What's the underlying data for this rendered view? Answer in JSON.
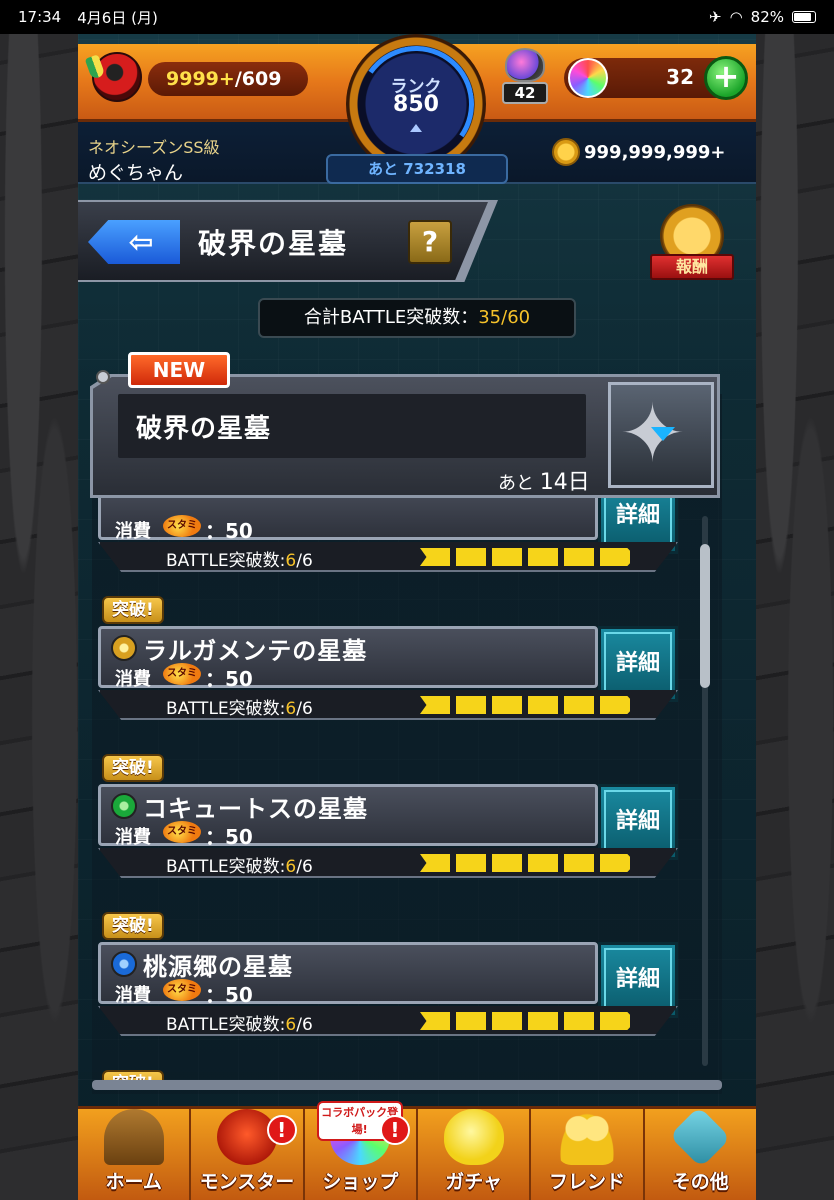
{
  "status_bar": {
    "time": "17:34",
    "date": "4月6日 (月)",
    "battery": "82%"
  },
  "hud": {
    "stamina_current": "9999+",
    "stamina_max": "/609",
    "rank_label": "ランク",
    "rank_value": "850",
    "exp_remaining": "あと 732318",
    "potion_count": "42",
    "orb_count": "32",
    "plus_label": "+",
    "player_title": "ネオシーズンSS級",
    "player_name": "めぐちゃん",
    "coins": "999,999,999+"
  },
  "page": {
    "back_arrow": "⇦",
    "title": "破界の星墓",
    "help": "?",
    "reward_label": "報酬",
    "total_label": "合計BATTLE突破数：",
    "total_value": "35/60"
  },
  "featured": {
    "new_label": "NEW",
    "name": "破界の星墓",
    "remaining_prefix": "あと",
    "remaining_days": "14日"
  },
  "quests": [
    {
      "tag": "",
      "name": "",
      "cost_label": "消費",
      "stamina_label": "スタミナ",
      "cost": "：50",
      "detail": "詳細",
      "progress_label": "BATTLE突破数:",
      "progress_done": "6",
      "progress_total": "/6"
    },
    {
      "tag": "突破!",
      "name": "ラルガメンテの星墓",
      "cost_label": "消費",
      "stamina_label": "スタミナ",
      "cost": "：50",
      "detail": "詳細",
      "progress_label": "BATTLE突破数:",
      "progress_done": "6",
      "progress_total": "/6",
      "element_color": "#d8a020"
    },
    {
      "tag": "突破!",
      "name": "コキュートスの星墓",
      "cost_label": "消費",
      "stamina_label": "スタミナ",
      "cost": "：50",
      "detail": "詳細",
      "progress_label": "BATTLE突破数:",
      "progress_done": "6",
      "progress_total": "/6",
      "element_color": "#1aa83a"
    },
    {
      "tag": "突破!",
      "name": "桃源郷の星墓",
      "cost_label": "消費",
      "stamina_label": "スタミナ",
      "cost": "：50",
      "detail": "詳細",
      "progress_label": "BATTLE突破数:",
      "progress_done": "6",
      "progress_total": "/6",
      "element_color": "#1a6ad8"
    }
  ],
  "next_tag": "突破!",
  "nav": {
    "items": [
      {
        "label": "ホーム",
        "icon": "home-gate-icon"
      },
      {
        "label": "モンスター",
        "icon": "monster-icon",
        "alert": "!"
      },
      {
        "label": "ショップ",
        "icon": "shop-orb-icon",
        "alert": "!",
        "badge": "コラボパック登場!"
      },
      {
        "label": "ガチャ",
        "icon": "gacha-egg-icon"
      },
      {
        "label": "フレンド",
        "icon": "friends-icon"
      },
      {
        "label": "その他",
        "icon": "other-icon"
      }
    ]
  }
}
